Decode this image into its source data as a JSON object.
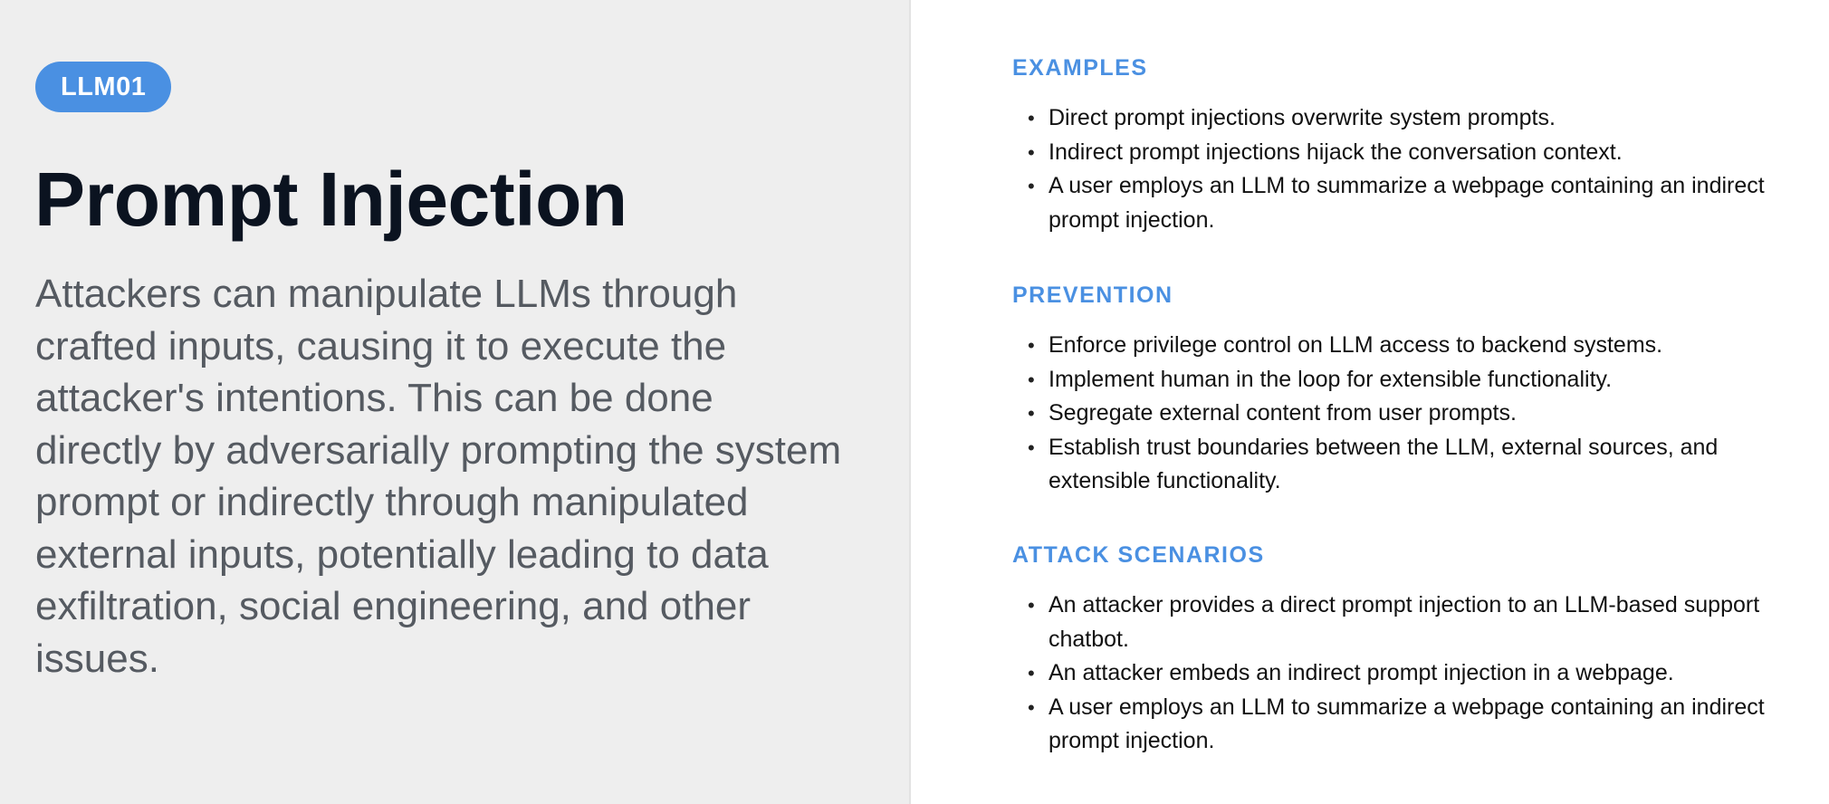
{
  "badge": {
    "label": "LLM01"
  },
  "title": "Prompt Injection",
  "description": "Attackers can manipulate LLMs through crafted inputs, causing it to execute the attacker's intentions. This can be done directly by adversarially prompting the system prompt or indirectly through manipulated external inputs, potentially leading to data exfiltration, social engineering, and other issues.",
  "colors": {
    "accent": "#4a90e2",
    "left_panel_bg": "#eeeeee",
    "title": "#0b1320",
    "body_text": "#555a61"
  },
  "sections": {
    "examples": {
      "heading": "EXAMPLES",
      "items": [
        "Direct prompt injections overwrite system prompts.",
        "Indirect prompt injections hijack the conversation context.",
        "A user employs an LLM to summarize a webpage containing an indirect prompt injection."
      ]
    },
    "prevention": {
      "heading": "PREVENTION",
      "items": [
        "Enforce privilege control on LLM access to backend systems.",
        "Implement human in the loop for extensible functionality.",
        "Segregate external content from user prompts.",
        "Establish trust boundaries between the LLM, external sources, and extensible functionality."
      ]
    },
    "attack_scenarios": {
      "heading": "ATTACK SCENARIOS",
      "items": [
        "An attacker provides a direct prompt injection to an LLM-based support chatbot.",
        "An attacker embeds an indirect prompt injection in a webpage.",
        "A user employs an LLM to summarize a webpage containing an indirect prompt injection."
      ]
    }
  }
}
